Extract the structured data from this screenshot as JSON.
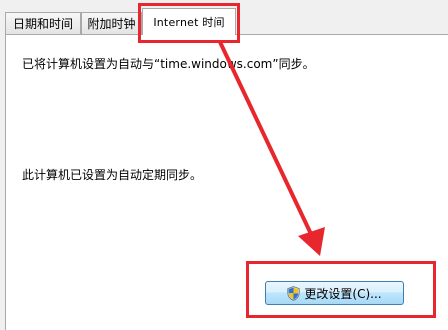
{
  "tabs": [
    {
      "label": "日期和时间"
    },
    {
      "label": "附加时钟"
    },
    {
      "label": "Internet 时间",
      "selected": true
    }
  ],
  "panel": {
    "sync_status_text": "已将计算机设置为自动与“time.windows.com”同步。",
    "schedule_text": "此计算机已设置为自动定期同步。"
  },
  "change_settings_button": {
    "label": "更改设置(C)...",
    "icon": "uac-shield-icon"
  },
  "annotations": {
    "color": "#e8262d"
  }
}
